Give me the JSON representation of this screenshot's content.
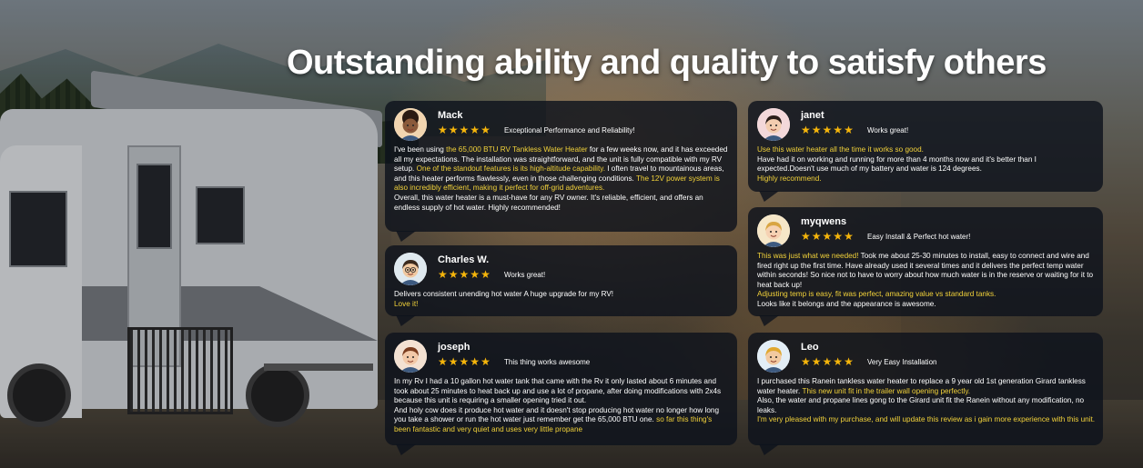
{
  "heading": "Outstanding ability and quality to satisfy others",
  "colors": {
    "highlight": "#f2d23a",
    "star": "#f5b50b",
    "card_bg": "#0e121c"
  },
  "reviews": [
    {
      "name": "Mack",
      "stars": 5,
      "title": "Exceptional Performance and Reliability!",
      "avatar": "avatar-curly-hair-man-icon",
      "lines": [
        [
          {
            "t": "I've been using "
          },
          {
            "t": "the 65,000 BTU RV Tankless Water Heater",
            "h": true
          },
          {
            "t": " for a few weeks now, and it has exceeded all my expectations. The installation was straightforward, and the unit is fully compatible with my RV setup. "
          },
          {
            "t": "One of the standout features is its high-altitude capability.",
            "h": true
          },
          {
            "t": " I often travel to mountainous areas, and this heater performs flawlessly, even in those challenging conditions. "
          },
          {
            "t": "The 12V power system is also incredibly efficient, making it perfect for off-grid adventures.",
            "h": true
          }
        ],
        [
          {
            "t": "Overall, this water heater is a must-have for any RV owner. It's reliable, efficient, and offers an endless supply of hot water. Highly recommended!"
          }
        ]
      ]
    },
    {
      "name": "Charles W.",
      "stars": 5,
      "title": "Works great!",
      "avatar": "avatar-glasses-man-icon",
      "lines": [
        [
          {
            "t": "Delivers consistent unending hot water A huge upgrade for my RV!"
          }
        ],
        [
          {
            "t": "Love it!",
            "h": true
          }
        ]
      ]
    },
    {
      "name": "joseph",
      "stars": 5,
      "title": "This thing works awesome",
      "avatar": "avatar-woman-brown-hair-icon",
      "lines": [
        [
          {
            "t": "In my Rv I had a 10 gallon hot water tank that came with the Rv it only lasted about 6 minutes and took about 25 minutes to heat back up and use a lot of propane, after doing modifications with 2x4s because this unit is requiring a smaller opening tried it out."
          }
        ],
        [
          {
            "t": "And holy cow does it produce hot water and it doesn't stop producing hot water no longer how long you take a shower or run the hot water just remember get the 65,000 BTU one. "
          },
          {
            "t": "so far this thing's been fantastic and very quiet and uses very little propane",
            "h": true
          }
        ]
      ]
    },
    {
      "name": "janet",
      "stars": 5,
      "title": "Works great!",
      "avatar": "avatar-dark-hair-woman-icon",
      "lines": [
        [
          {
            "t": "Use this water heater all the time it works so good.",
            "h": true
          }
        ],
        [
          {
            "t": "Have had it on working and running for more than 4 months now and it's better than I expected.Doesn't use much of my battery and water is 124 degrees."
          }
        ],
        [
          {
            "t": "Highly recommend.",
            "h": true
          }
        ]
      ]
    },
    {
      "name": "myqwens",
      "stars": 5,
      "title": "Easy Install & Perfect hot water!",
      "avatar": "avatar-blonde-woman-icon",
      "lines": [
        [
          {
            "t": "This was just what we needed!",
            "h": true
          },
          {
            "t": " Took me about 25-30 minutes to install, easy to connect and wire and fired right up the first time. Have already used it several times and it delivers the perfect temp water within seconds! So nice not to have to worry about how much water is in the reserve or waiting for it to heat back up!"
          }
        ],
        [
          {
            "t": "Adjusting temp is easy, fit was perfect, amazing value vs standard tanks.",
            "h": true
          }
        ],
        [
          {
            "t": "Looks like it belongs and the appearance is awesome."
          }
        ]
      ]
    },
    {
      "name": "Leo",
      "stars": 5,
      "title": "Very Easy Installation",
      "avatar": "avatar-blond-man-icon",
      "lines": [
        [
          {
            "t": "I purchased this Ranein tankless water heater to replace a 9 year old 1st generation Girard tankless water heater. "
          },
          {
            "t": "This new unit fit in the trailer wall opening perfectly.",
            "h": true
          }
        ],
        [
          {
            "t": "Also, the water and propane lines gong to the Girard unit fit the Ranein without any modification, no leaks."
          }
        ],
        [
          {
            "t": "I'm very pleased with my purchase, and will update this review as i gain more experience with this unit.",
            "h": true
          }
        ]
      ]
    }
  ]
}
